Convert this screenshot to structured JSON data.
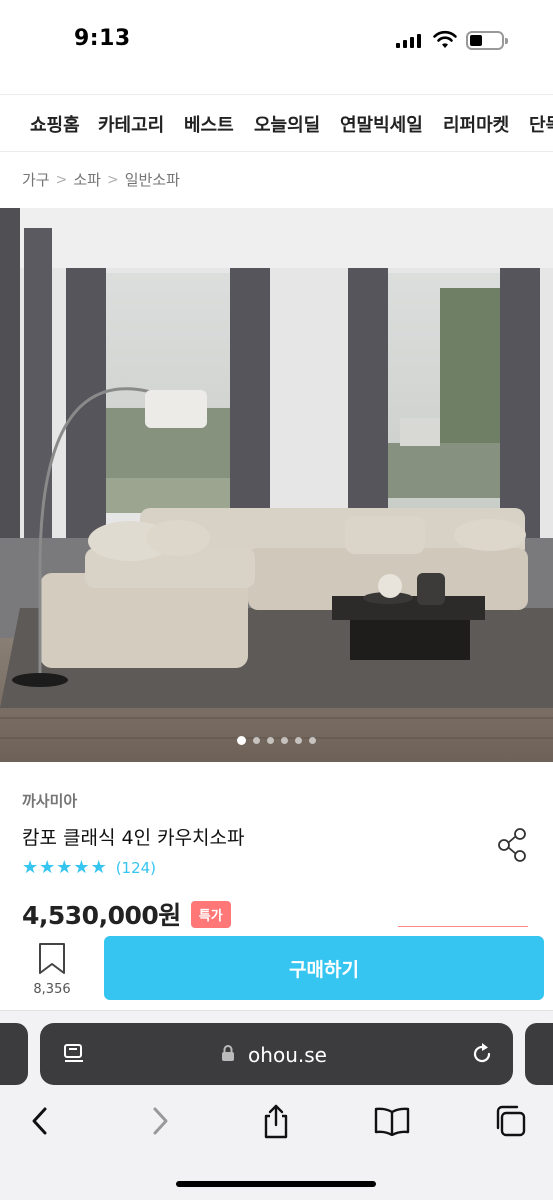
{
  "status_bar": {
    "time": "9:13"
  },
  "category_nav": {
    "items": [
      "쇼핑홈",
      "카테고리",
      "베스트",
      "오늘의딜",
      "연말빅세일",
      "리퍼마켓",
      "단독"
    ]
  },
  "breadcrumb": {
    "items": [
      "가구",
      "소파",
      "일반소파"
    ]
  },
  "gallery": {
    "slide_count": 6,
    "active_index": 0
  },
  "product": {
    "brand": "까사미아",
    "title": "캄포 클래식 4인 카우치소파",
    "rating_stars": 5,
    "review_count": "(124)",
    "price": "4,530,000원",
    "badge": "특가"
  },
  "buy_bar": {
    "bookmark_count": "8,356",
    "buy_label": "구매하기"
  },
  "browser": {
    "url": "ohou.se"
  },
  "colors": {
    "accent": "#35c5f0",
    "badge": "#ff7777",
    "url_bar": "#3c3c3f"
  },
  "icons": [
    "signal-icon",
    "wifi-icon",
    "battery-icon",
    "share-icon",
    "bookmark-icon",
    "lock-icon",
    "reader-icon",
    "reload-icon",
    "back-icon",
    "forward-icon",
    "share-sheet-icon",
    "bookmarks-icon",
    "tabs-icon"
  ]
}
